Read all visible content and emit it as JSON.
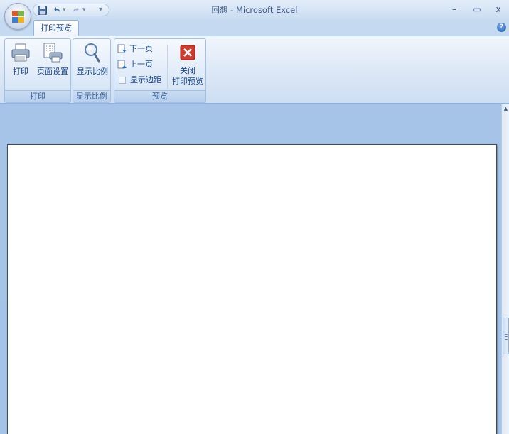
{
  "window": {
    "title": "回想 - Microsoft Excel",
    "minimize_glyph": "–",
    "restore_glyph": "▭",
    "close_glyph": "x"
  },
  "quick_access": {
    "icons": [
      "save-icon",
      "undo-icon",
      "redo-icon",
      "customize-qat-icon"
    ]
  },
  "tabs": [
    {
      "label": "打印预览",
      "active": true
    }
  ],
  "help": {
    "glyph": "?"
  },
  "ribbon": {
    "groups": {
      "print": {
        "label": "打印",
        "buttons": [
          {
            "label": "打印",
            "icon": "printer-icon"
          },
          {
            "label": "页面设置",
            "icon": "page-setup-icon"
          }
        ]
      },
      "zoom": {
        "label": "显示比例",
        "buttons": [
          {
            "label": "显示比例",
            "icon": "magnifier-icon"
          }
        ]
      },
      "preview": {
        "label": "预览",
        "next_page": "下一页",
        "prev_page": "上一页",
        "show_margins": {
          "label": "显示边距",
          "checked": false
        },
        "close_line1": "关闭",
        "close_line2": "打印预览"
      }
    }
  },
  "colors": {
    "workspace": "#a3c3e8",
    "ribbon_text": "#15428b",
    "close_button": "#d23a2d"
  }
}
